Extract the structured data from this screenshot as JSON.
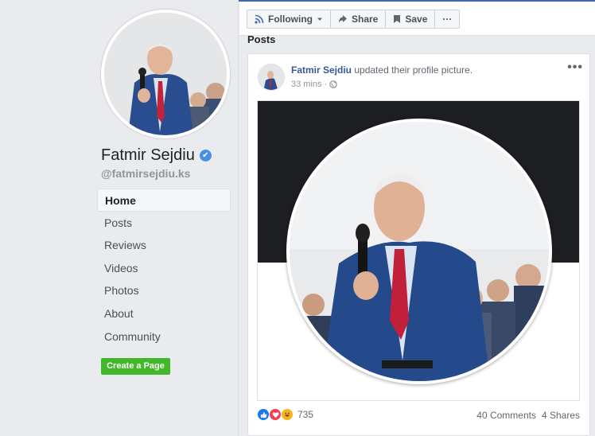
{
  "page": {
    "name": "Fatmir Sejdiu",
    "handle": "@fatmirsejdiu.ks",
    "verified_mark": "✔"
  },
  "nav": {
    "items": [
      "Home",
      "Posts",
      "Reviews",
      "Videos",
      "Photos",
      "About",
      "Community"
    ],
    "active": "Home"
  },
  "create_page_label": "Create a Page",
  "actions": {
    "following_label": "Following",
    "share_label": "Share",
    "save_label": "Save",
    "more_label": "···"
  },
  "posts_heading": "Posts",
  "post": {
    "author": "Fatmir Sejdiu",
    "action_text": "updated their profile picture.",
    "time": "33 mins",
    "privacy_icon": "globe-icon",
    "menu_dots": "•••",
    "reaction_count": "735",
    "comments": "40 Comments",
    "shares": "4 Shares"
  },
  "colors": {
    "brand_blue": "#4267b2",
    "link_blue": "#365899",
    "green": "#42b72a",
    "dark_banner": "#1c1e21"
  }
}
